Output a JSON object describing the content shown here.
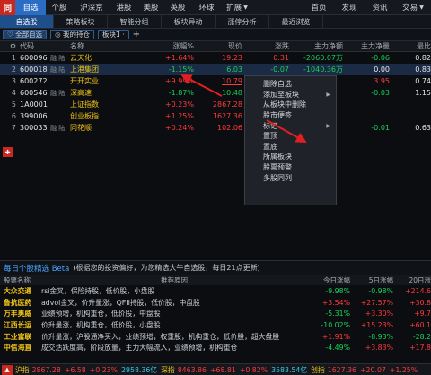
{
  "menubar": {
    "logo": "同",
    "items": [
      "自选",
      "个股",
      "沪深京",
      "港股",
      "美股",
      "英股",
      "环球",
      "扩展",
      "资讯",
      "发现",
      "资讯",
      "交易"
    ],
    "left_items": [
      "自选",
      "个股",
      "沪深京",
      "港股",
      "美股",
      "英股",
      "环球",
      "扩展"
    ],
    "right_items": [
      "首页",
      "发现",
      "资讯",
      "交易"
    ]
  },
  "subtabs": [
    "自选股",
    "策略板块",
    "智能分组",
    "板块异动",
    "涨停分析",
    "最近浏览"
  ],
  "toolbar": {
    "all": "♡ 全部自选",
    "holding": "◎ 我的持仓",
    "block": "板块1 ·",
    "add": "+"
  },
  "table": {
    "headers": [
      "代码",
      "名称",
      "涨幅%",
      "现价",
      "涨跌",
      "主力净额",
      "主力净量",
      "最比"
    ],
    "rows": [
      {
        "idx": "1",
        "code": "600096",
        "tag": "融 陆",
        "name": "云天化",
        "chg": "+1.64%",
        "price": "19.23",
        "rise": "0.31",
        "net": "-2060.07万",
        "net2": "-0.06",
        "last": "0.82"
      },
      {
        "idx": "2",
        "code": "600018",
        "tag": "融 陆",
        "name": "上港集团",
        "chg": "-1.15%",
        "price": "6.03",
        "rise": "-0.07",
        "net": "-1040.36万",
        "net2": "0.00",
        "last": "0.83"
      },
      {
        "idx": "3",
        "code": "600272",
        "tag": "",
        "name": "开开实业",
        "chg": "+9.99%",
        "price": "10.79",
        "rise": "",
        "net": "",
        "net2": "3.95",
        "last": "0.74"
      },
      {
        "idx": "4",
        "code": "600546",
        "tag": "融 陆",
        "name": "深高速",
        "chg": "-1.87%",
        "price": "10.48",
        "rise": "",
        "net": "",
        "net2": "-0.03",
        "last": "1.15"
      },
      {
        "idx": "5",
        "code": "1A0001",
        "tag": "",
        "name": "上证指数",
        "chg": "+0.23%",
        "price": "2867.28",
        "rise": "",
        "net": "",
        "net2": "",
        "last": ""
      },
      {
        "idx": "6",
        "code": "399006",
        "tag": "",
        "name": "创业板指",
        "chg": "+1.25%",
        "price": "1627.36",
        "rise": "",
        "net": "",
        "net2": "",
        "last": ""
      },
      {
        "idx": "7",
        "code": "300033",
        "tag": "融 陆",
        "name": "同花顺",
        "chg": "+0.24%",
        "price": "102.06",
        "rise": "",
        "net": "",
        "net2": "-0.01",
        "last": "0.63"
      }
    ]
  },
  "context_menu": [
    "删除自选",
    "添加至板块",
    "从板块中删除",
    "股市便签",
    "标记",
    "置顶",
    "置底",
    "所属板块",
    "股票预警",
    "多股同列"
  ],
  "panel": {
    "title": "每日个股精选 Beta",
    "subtitle": "(根据您的投资偏好，为您精选大牛自选股，每日21点更新)"
  },
  "bottom": {
    "headers": [
      "股票名称",
      "推荐原因",
      "今日涨幅",
      "5日涨幅",
      "20日涨"
    ],
    "rows": [
      {
        "name": "大众交通",
        "reason": "rsi金叉，保险持股，低价股，小盘股",
        "d1": "-9.98%",
        "d5": "-0.98%",
        "d20": "+214.6"
      },
      {
        "name": "鲁抗医药",
        "reason": "advol金叉，价升量涨，QFII持股，低价股，中盘股",
        "d1": "+3.54%",
        "d5": "+27.57%",
        "d20": "+30.8"
      },
      {
        "name": "万丰奥威",
        "reason": "业绩预增，机构重仓，低价股，中盘股",
        "d1": "-5.31%",
        "d5": "+3.30%",
        "d20": "+9.7"
      },
      {
        "name": "江西长运",
        "reason": "价升量涨，机构重仓，低价股，小盘股",
        "d1": "-10.02%",
        "d5": "+15.23%",
        "d20": "+60.1"
      },
      {
        "name": "工业富联",
        "reason": "价升量涨，沪股通净买入，业绩预增，权重股，机构重仓，低价股，超大盘股",
        "d1": "+1.91%",
        "d5": "-8.93%",
        "d20": "-28.2"
      },
      {
        "name": "中信海直",
        "reason": "成交活跃度高，阶段放量，主力大幅流入，业绩预增，机构重仓",
        "d1": "-4.49%",
        "d5": "+3.83%",
        "d20": "+17.8"
      }
    ]
  },
  "status": {
    "sh_name": "沪指",
    "sh_val": "2867.28",
    "sh_chg": "+6.58",
    "sh_pct": "+0.23%",
    "sh_amt": "2958.36亿",
    "sz_name": "深指",
    "sz_val": "8463.86",
    "sz_chg": "+68.81",
    "sz_pct": "+0.82%",
    "sz_amt": "3583.54亿",
    "cy_name": "创指",
    "cy_val": "1627.36",
    "cy_chg": "+20.07",
    "cy_pct": "+1.25%"
  },
  "colors": {
    "accent": "#2b6cc4",
    "up": "#ff3b3b",
    "down": "#18d05a",
    "bg": "#0b0d10"
  }
}
